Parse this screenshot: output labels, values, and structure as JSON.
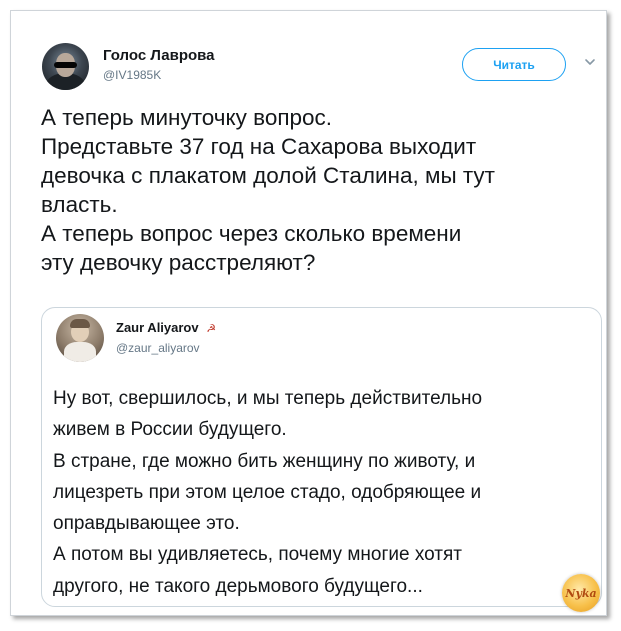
{
  "tweet": {
    "author_name": "Голос Лаврова",
    "author_handle": "@IV1985K",
    "follow_label": "Читать",
    "text_lines": [
      "А теперь минуточку вопрос.",
      "Представьте 37 год на Сахарова выходит",
      "девочка с плакатом долой Сталина, мы тут",
      "власть.",
      "А теперь вопрос через сколько времени",
      "эту девочку расстреляют?"
    ]
  },
  "quoted_tweet": {
    "author_name": "Zaur Aliyarov",
    "author_flag": "☭",
    "author_handle": "@zaur_aliyarov",
    "text_lines": [
      "Ну вот, свершилось, и мы теперь действительно",
      "живем в России будущего.",
      "В стране, где можно бить женщину по животу, и",
      "лицезреть при этом целое стадо, одобряющее и",
      "оправдывающее это.",
      "А потом вы удивляетесь, почему многие хотят",
      "другого, не такого дерьмового будущего..."
    ]
  },
  "watermark": {
    "label": "Nyka"
  },
  "colors": {
    "accent": "#1da1f2",
    "secondary_text": "#657786",
    "border": "#ccd6dd"
  },
  "icons": {
    "menu": "chevron-down-icon",
    "flag": "hammer-sickle-icon"
  }
}
